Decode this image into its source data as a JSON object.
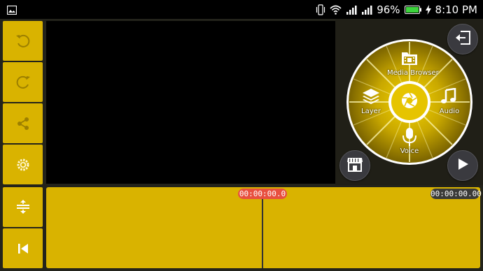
{
  "status_bar": {
    "battery_percent": "96%",
    "time": "8:10",
    "time_suffix": "PM"
  },
  "toolbar": {
    "buttons": [
      "undo-icon",
      "redo-icon",
      "share-icon",
      "settings-icon"
    ]
  },
  "media_wheel": {
    "top_label": "Media Browser",
    "left_label": "Layer",
    "right_label": "Audio",
    "bottom_label": "Voice",
    "center": "camera-shutter-icon"
  },
  "corner_buttons": {
    "exit": "exit-icon",
    "store": "store-icon",
    "play": "play-icon"
  },
  "timeline": {
    "current_time": "00:00:00.0",
    "total_time": "00:00:00.00",
    "tools": [
      "expand-timeline-icon",
      "skip-to-start-icon"
    ]
  },
  "colors": {
    "accent": "#d9b300",
    "playhead_badge": "#e8503f"
  }
}
